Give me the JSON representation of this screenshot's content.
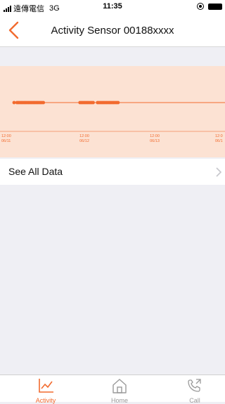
{
  "status_bar": {
    "carrier": "遠傳電信",
    "network": "3G",
    "time": "11:35"
  },
  "nav": {
    "title": "Activity Sensor 00188xxxx",
    "back_icon": "chevron-left-icon"
  },
  "chart_data": {
    "type": "scatter",
    "x_ticks": [
      {
        "time": "12:00",
        "date": "06/11"
      },
      {
        "time": "12:00",
        "date": "06/12"
      },
      {
        "time": "12:00",
        "date": "06/13"
      },
      {
        "time": "12:0",
        "date": "06/1"
      }
    ],
    "series": [
      {
        "values_hours_from_first_tick": [
          0.0,
          1.0,
          1.5,
          2.0,
          2.5,
          3.0,
          3.5,
          4.0,
          4.5,
          5.0,
          5.5,
          6.0,
          6.5,
          7.0,
          7.5,
          8.0,
          8.5,
          9.0,
          9.5,
          10.0,
          22.5,
          23.0,
          23.5,
          24.0,
          24.5,
          25.0,
          25.5,
          26.0,
          26.5,
          27.0,
          28.5,
          29.0,
          29.5,
          30.0,
          30.5,
          31.0,
          31.5,
          32.0,
          32.5,
          33.0,
          33.5,
          34.0,
          34.5,
          35.0,
          35.5,
          72.5,
          73.0
        ]
      }
    ],
    "grid": false,
    "colors": {
      "panel": "#fce2d3",
      "marks": "#f26b2f",
      "line": "#f5a07a"
    }
  },
  "see_all": {
    "label": "See All Data",
    "chevron_icon": "chevron-right-icon"
  },
  "tabs": [
    {
      "label": "Activity",
      "icon": "activity-chart-icon",
      "active": true
    },
    {
      "label": "Home",
      "icon": "home-icon",
      "active": false
    },
    {
      "label": "Call",
      "icon": "phone-icon",
      "active": false
    }
  ],
  "colors": {
    "accent": "#f26b2f",
    "tab_inactive": "#9a9a9a"
  }
}
